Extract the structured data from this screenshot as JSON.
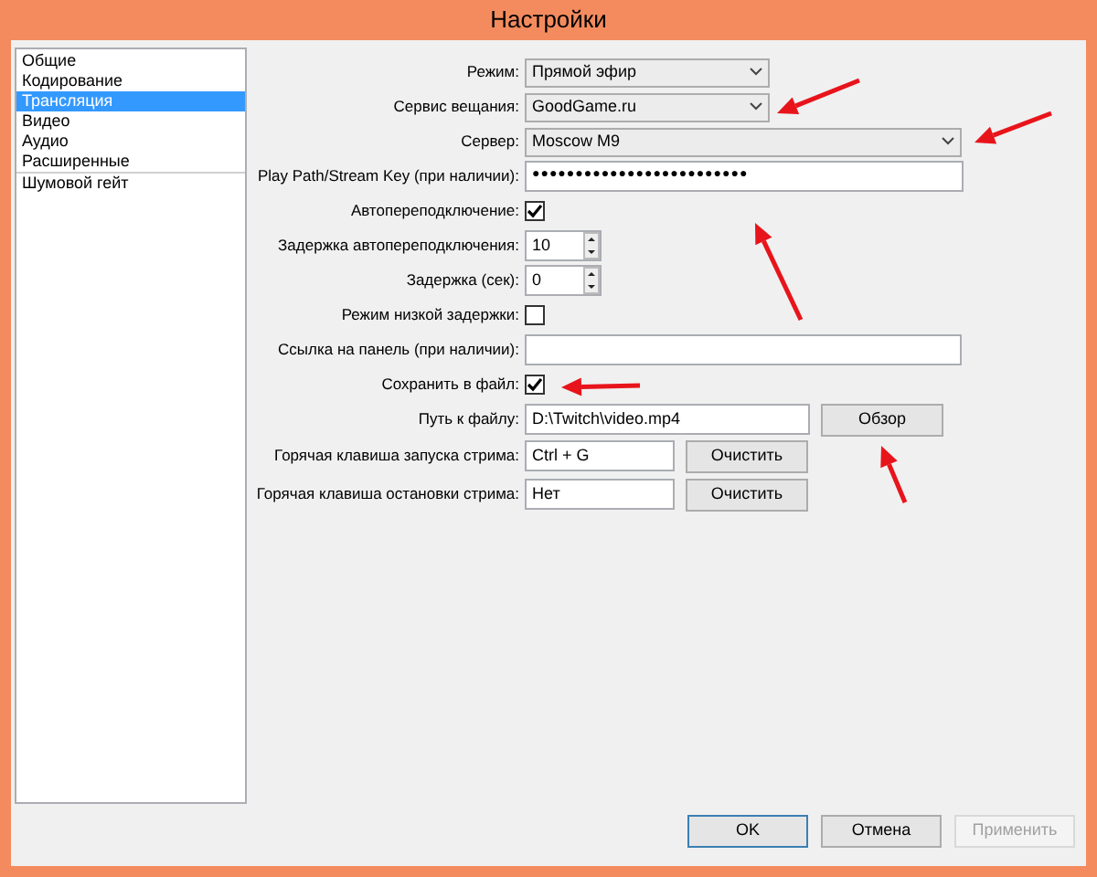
{
  "window": {
    "title": "Настройки"
  },
  "sidebar": {
    "groups": [
      [
        {
          "label": "Общие",
          "selected": false
        },
        {
          "label": "Кодирование",
          "selected": false
        },
        {
          "label": "Трансляция",
          "selected": true
        },
        {
          "label": "Видео",
          "selected": false
        },
        {
          "label": "Аудио",
          "selected": false
        },
        {
          "label": "Расширенные",
          "selected": false
        }
      ],
      [
        {
          "label": "Шумовой гейт",
          "selected": false
        }
      ]
    ]
  },
  "form": [
    {
      "kind": "select",
      "label": "Режим:",
      "value": "Прямой эфир",
      "wide": false
    },
    {
      "kind": "select",
      "label": "Сервис вещания:",
      "value": "GoodGame.ru",
      "wide": false
    },
    {
      "kind": "select",
      "label": "Сервер:",
      "value": "Moscow M9",
      "wide": true
    },
    {
      "kind": "password",
      "label": "Play Path/Stream Key (при наличии):",
      "value": "●●●●●●●●●●●●●●●●●●●●●●●●●"
    },
    {
      "kind": "checkbox",
      "label": "Автопереподключение:",
      "checked": true
    },
    {
      "kind": "spin",
      "label": "Задержка автопереподключения:",
      "value": "10"
    },
    {
      "kind": "spin",
      "label": "Задержка (сек):",
      "value": "0"
    },
    {
      "kind": "checkbox",
      "label": "Режим низкой задержки:",
      "checked": false
    },
    {
      "kind": "text",
      "label": "Ссылка на панель (при наличии):"
    },
    {
      "kind": "checkbox",
      "label": "Сохранить в файл:",
      "checked": true
    },
    {
      "kind": "file",
      "label": "Путь к файлу:",
      "value": "D:\\Twitch\\video.mp4",
      "button": "Обзор"
    },
    {
      "kind": "hotkey",
      "label": "Горячая клавиша запуска стрима:",
      "value": "Ctrl + G",
      "button": "Очистить"
    },
    {
      "kind": "hotkey",
      "label": "Горячая клавиша остановки стрима:",
      "value": "Нет",
      "button": "Очистить"
    }
  ],
  "buttons": [
    {
      "label": "OK",
      "disabled": false,
      "default": true
    },
    {
      "label": "Отмена",
      "disabled": false,
      "default": false
    },
    {
      "label": "Применить",
      "disabled": true,
      "default": false
    }
  ]
}
